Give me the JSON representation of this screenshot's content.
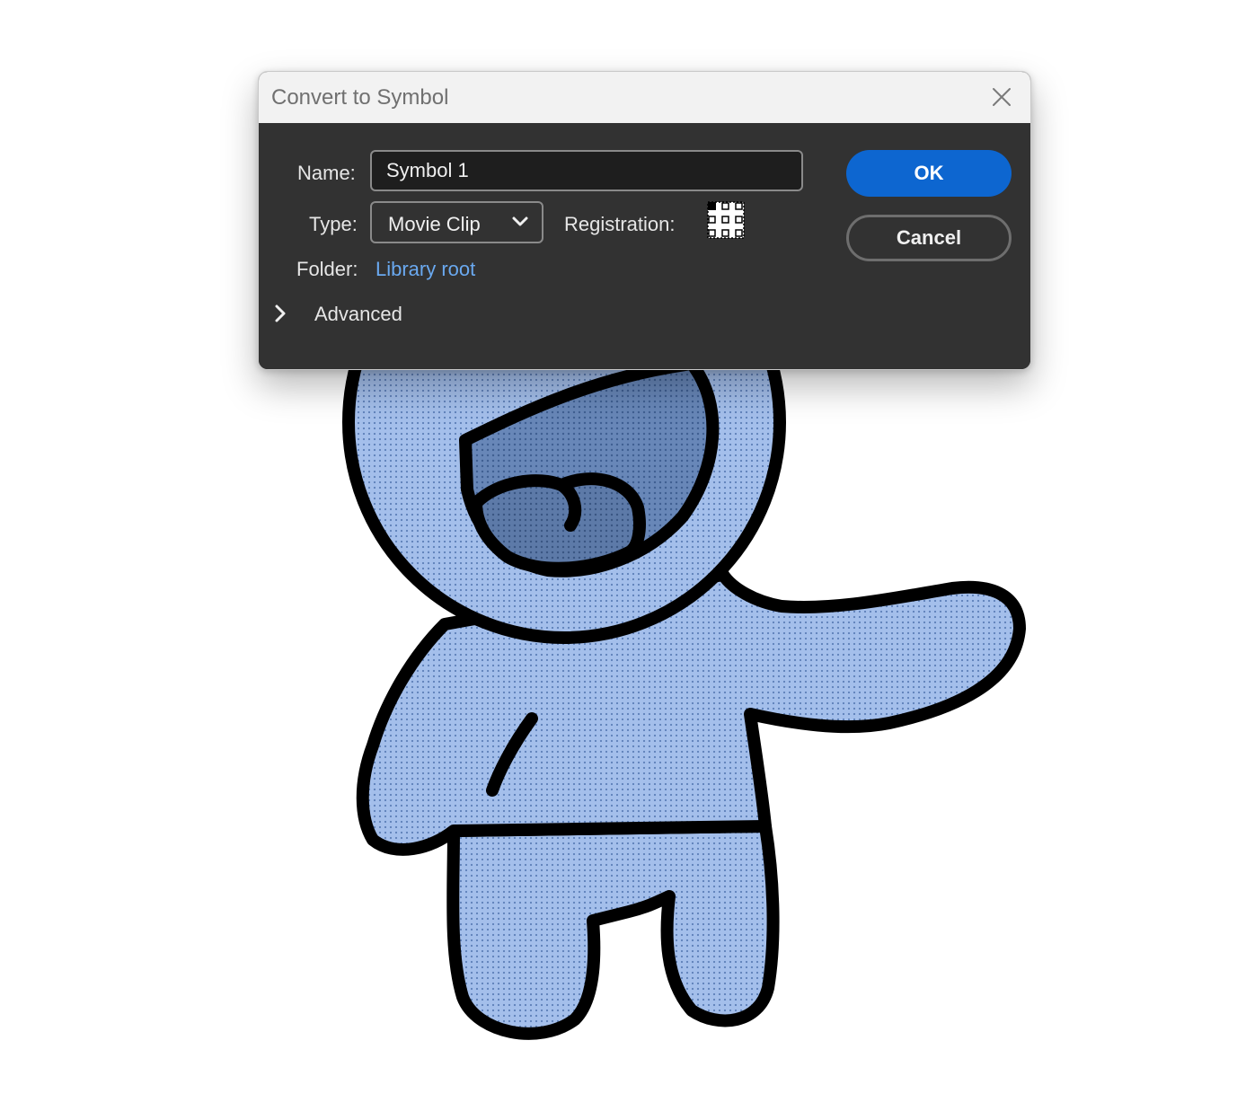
{
  "dialog": {
    "title": "Convert to Symbol",
    "close_icon": "close-icon",
    "name_label": "Name:",
    "name_value": "Symbol 1",
    "type_label": "Type:",
    "type_value": "Movie Clip",
    "type_dropdown_icon": "chevron-down-icon",
    "registration_label": "Registration:",
    "registration_selected": "top-left",
    "folder_label": "Folder:",
    "folder_value": "Library root",
    "advanced_label": "Advanced",
    "advanced_icon": "chevron-right-icon",
    "ok_label": "OK",
    "cancel_label": "Cancel"
  },
  "colors": {
    "titlebar": "#f2f2f2",
    "dialog_body": "#323232",
    "ok_button": "#0d66d0",
    "folder_link": "#6aa9f0",
    "character_fill": "#9db9e6"
  }
}
